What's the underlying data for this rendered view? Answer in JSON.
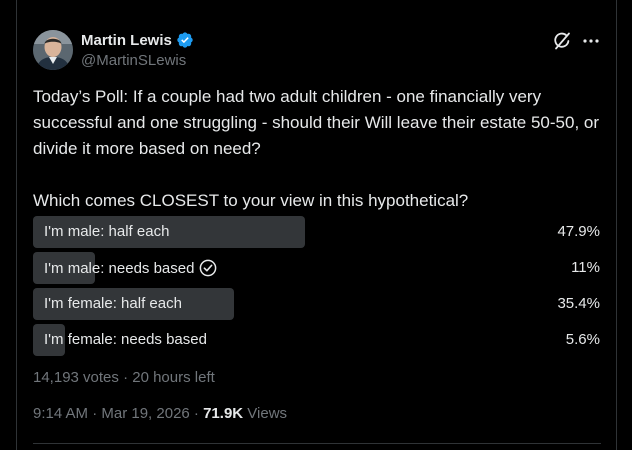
{
  "author": {
    "name": "Martin Lewis",
    "handle": "@MartinSLewis",
    "verified_color": "#1d9bf0",
    "avatar_icon": "profile-photo"
  },
  "header_icons": {
    "grok": "grok-icon",
    "more": "more-icon"
  },
  "tweet": {
    "text_1": "Today’s Poll: If a couple had two adult children - one financially very successful and one struggling - should their Will leave their estate 50-50, or divide it more based on need?",
    "text_2": "Which comes CLOSEST to your view in this hypothetical?"
  },
  "poll": {
    "options": [
      {
        "label": "I'm male: half each",
        "percent": 47.9,
        "percent_text": "47.9%",
        "voted": false
      },
      {
        "label": "I'm male: needs based",
        "percent": 11,
        "percent_text": "11%",
        "voted": true
      },
      {
        "label": "I'm female: half each",
        "percent": 35.4,
        "percent_text": "35.4%",
        "voted": false
      },
      {
        "label": "I'm female: needs based",
        "percent": 5.6,
        "percent_text": "5.6%",
        "voted": false
      }
    ],
    "meta": "14,193 votes · 20 hours left"
  },
  "meta": {
    "timestamp": "9:14 AM · Mar 19, 2026 · ",
    "views_count": "71.9K",
    "views_label": " Views"
  },
  "colors": {
    "background": "#000000",
    "text": "#e7e9ea",
    "secondary": "#71767b",
    "bar": "#333639",
    "divider": "#2f3336"
  }
}
